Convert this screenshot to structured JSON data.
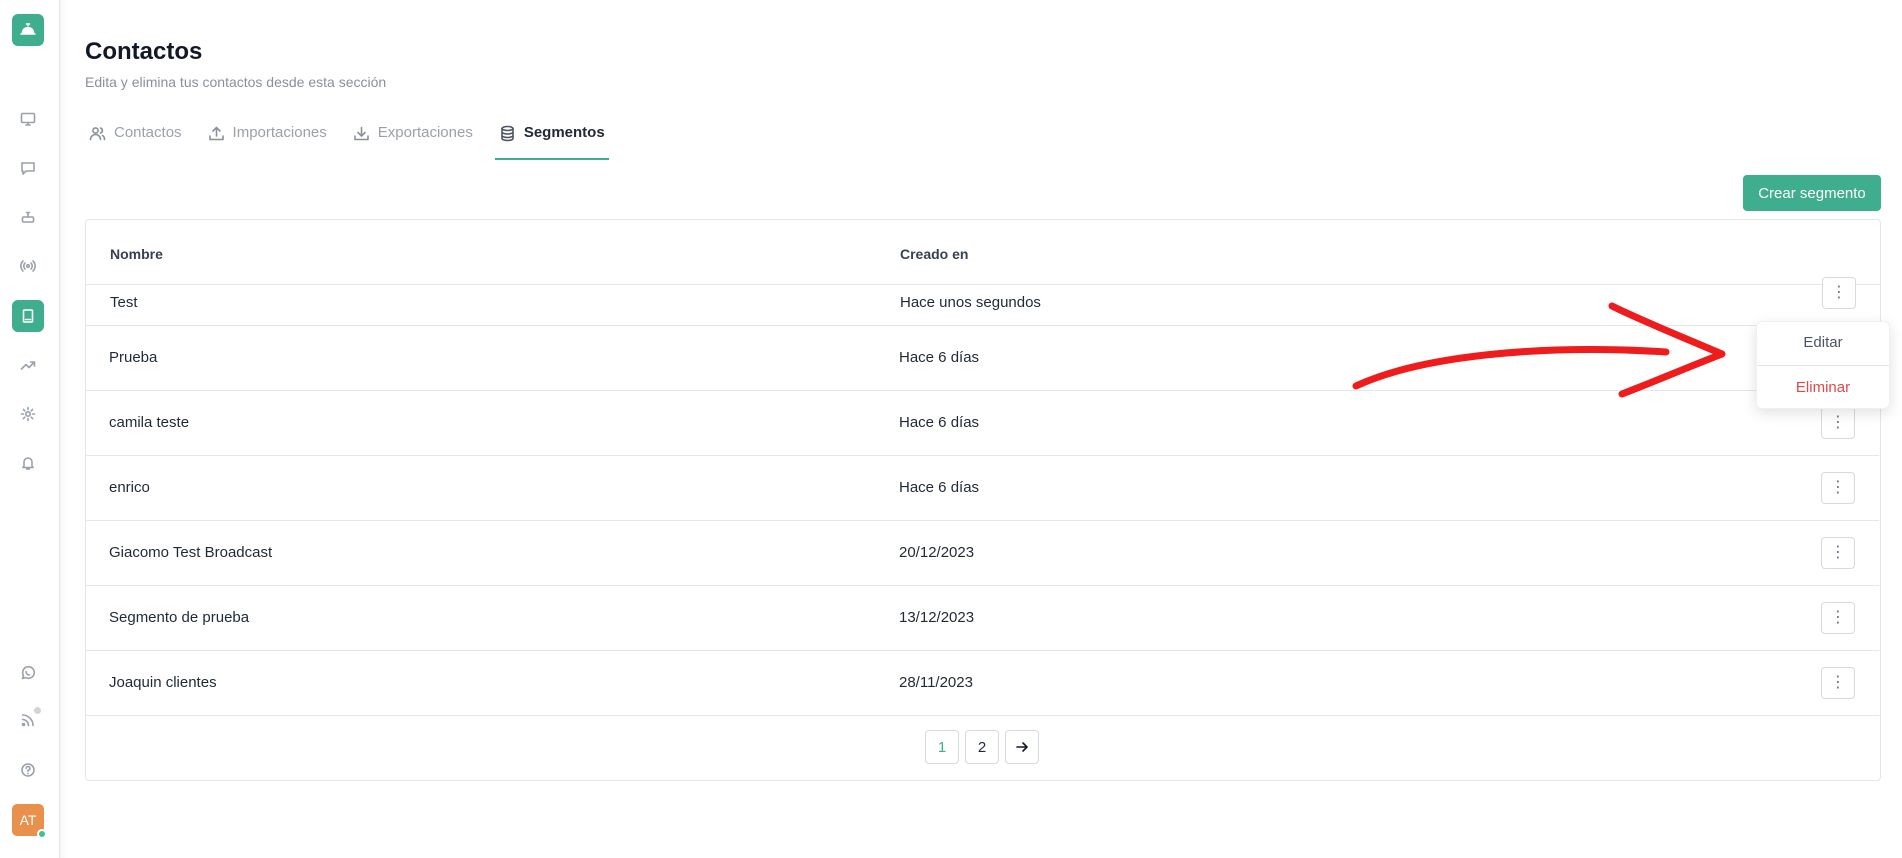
{
  "sidebar": {
    "avatar_initials": "AT",
    "icons": [
      "logo-bell-icon",
      "monitor-icon",
      "chat-icon",
      "bot-icon",
      "broadcast-icon",
      "book-icon",
      "trending-icon",
      "gear-icon",
      "bell-icon",
      "whatsapp-icon",
      "rss-icon",
      "help-icon"
    ],
    "accent_color": "#3fae8e"
  },
  "header": {
    "title": "Contactos",
    "subtitle": "Edita y elimina tus contactos desde esta sección"
  },
  "tabs": [
    {
      "label": "Contactos",
      "icon": "users-icon",
      "active": false
    },
    {
      "label": "Importaciones",
      "icon": "upload-icon",
      "active": false
    },
    {
      "label": "Exportaciones",
      "icon": "download-icon",
      "active": false
    },
    {
      "label": "Segmentos",
      "icon": "database-icon",
      "active": true
    }
  ],
  "actions": {
    "create_label": "Crear segmento"
  },
  "table": {
    "columns": [
      "Nombre",
      "Creado en"
    ],
    "rows": [
      {
        "name": "Test",
        "created": "Hace unos segundos"
      },
      {
        "name": "Prueba",
        "created": "Hace 6 días"
      },
      {
        "name": "camila teste",
        "created": "Hace 6 días"
      },
      {
        "name": "enrico",
        "created": "Hace 6 días"
      },
      {
        "name": "Giacomo Test Broadcast",
        "created": "20/12/2023"
      },
      {
        "name": "Segmento de prueba",
        "created": "13/12/2023"
      },
      {
        "name": "Joaquin clientes",
        "created": "28/11/2023"
      }
    ]
  },
  "pagination": {
    "pages": [
      "1",
      "2"
    ],
    "current": "1",
    "next_icon": "arrow-right-icon"
  },
  "dropdown": {
    "edit_label": "Editar",
    "delete_label": "Eliminar"
  }
}
